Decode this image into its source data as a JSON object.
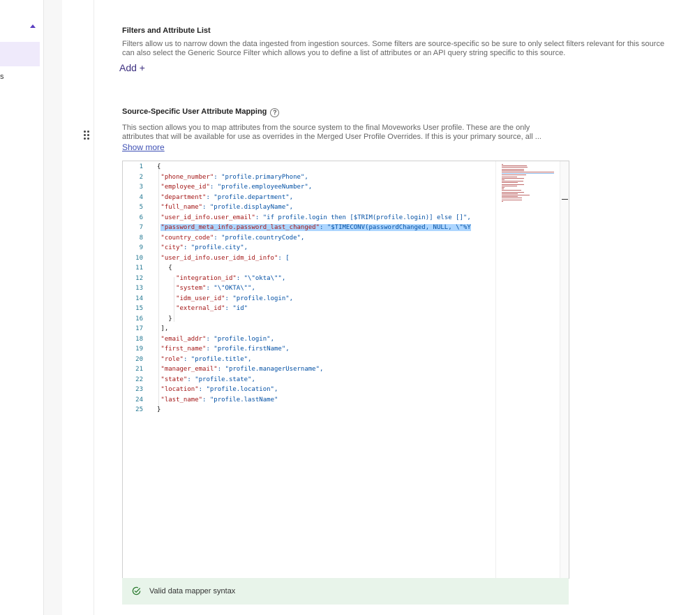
{
  "nav": {
    "fragment": "s"
  },
  "filters": {
    "title": "Filters and Attribute List",
    "description_line1": "Filters allow us to narrow down the data ingested from ingestion sources. Some filters are source-specific so be sure to only select filters relevant for this source",
    "description_line2": "can also select the Generic Source Filter which allows you to define a list of attributes or an API query string specific to this source.",
    "add_label": "Add +"
  },
  "mapping": {
    "title": "Source-Specific User Attribute Mapping",
    "help_glyph": "?",
    "description_line1": "This section allows you to map attributes from the source system to the final Moveworks User profile. These are the only",
    "description_line2": "attributes that will be available for use as overrides in the Merged User Profile Overrides. If this is your primary source, all ...",
    "show_more": "Show more"
  },
  "editor": {
    "line_numbers": [
      "1",
      "2",
      "3",
      "4",
      "5",
      "6",
      "7",
      "8",
      "9",
      "10",
      "11",
      "12",
      "13",
      "14",
      "15",
      "16",
      "17",
      "18",
      "19",
      "20",
      "21",
      "22",
      "23",
      "24",
      "25"
    ],
    "lines": [
      {
        "indent": "",
        "key": "",
        "rest": "{"
      },
      {
        "indent": " ",
        "key": "\"phone_number\"",
        "rest": ": \"profile.primaryPhone\","
      },
      {
        "indent": " ",
        "key": "\"employee_id\"",
        "rest": ": \"profile.employeeNumber\","
      },
      {
        "indent": " ",
        "key": "\"department\"",
        "rest": ": \"profile.department\","
      },
      {
        "indent": " ",
        "key": "\"full_name\"",
        "rest": ": \"profile.displayName\","
      },
      {
        "indent": " ",
        "key": "\"user_id_info.user_email\"",
        "rest": ": \"if profile.login then [$TRIM(profile.login)] else []\","
      },
      {
        "indent": " ",
        "key": "\"password_meta_info.password_last_changed\"",
        "rest": ": \"$TIMECONV(passwordChanged, NULL, \\\"%Y"
      },
      {
        "indent": " ",
        "key": "\"country_code\"",
        "rest": ": \"profile.countryCode\","
      },
      {
        "indent": " ",
        "key": "\"city\"",
        "rest": ": \"profile.city\","
      },
      {
        "indent": " ",
        "key": "\"user_id_info.user_idm_id_info\"",
        "rest": ": ["
      },
      {
        "indent": "   ",
        "key": "",
        "rest": "{"
      },
      {
        "indent": "     ",
        "key": "\"integration_id\"",
        "rest": ": \"\\\"okta\\\"\","
      },
      {
        "indent": "     ",
        "key": "\"system\"",
        "rest": ": \"\\\"OKTA\\\"\","
      },
      {
        "indent": "     ",
        "key": "\"idm_user_id\"",
        "rest": ": \"profile.login\","
      },
      {
        "indent": "     ",
        "key": "\"external_id\"",
        "rest": ": \"id\""
      },
      {
        "indent": "   ",
        "key": "",
        "rest": "}"
      },
      {
        "indent": " ",
        "key": "",
        "rest": "],"
      },
      {
        "indent": " ",
        "key": "\"email_addr\"",
        "rest": ": \"profile.login\","
      },
      {
        "indent": " ",
        "key": "\"first_name\"",
        "rest": ": \"profile.firstName\","
      },
      {
        "indent": " ",
        "key": "\"role\"",
        "rest": ": \"profile.title\","
      },
      {
        "indent": " ",
        "key": "\"manager_email\"",
        "rest": ": \"profile.managerUsername\","
      },
      {
        "indent": " ",
        "key": "\"state\"",
        "rest": ": \"profile.state\","
      },
      {
        "indent": " ",
        "key": "\"location\"",
        "rest": ": \"profile.location\","
      },
      {
        "indent": " ",
        "key": "\"last_name\"",
        "rest": ": \"profile.lastName\""
      },
      {
        "indent": "",
        "key": "",
        "rest": "}"
      }
    ],
    "selected_line": 7
  },
  "validation": {
    "message": "Valid data mapper syntax",
    "color": "#2e7d32"
  },
  "colors": {
    "accent": "#5a3fc0",
    "link": "#3f51b5",
    "valid_bg": "#e8f4ea"
  }
}
